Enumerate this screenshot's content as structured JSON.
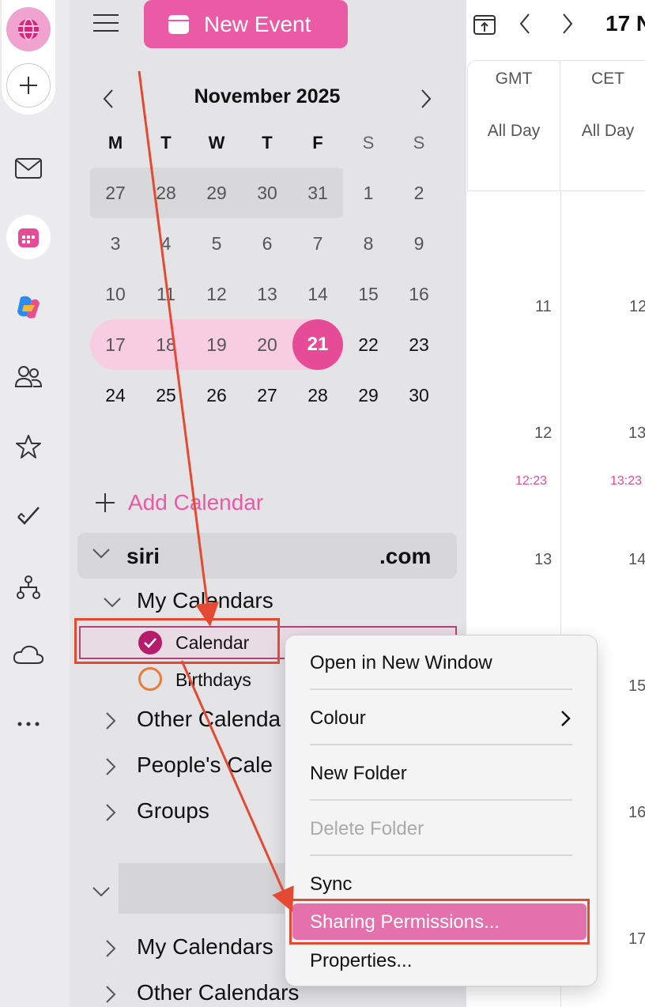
{
  "toolbar": {
    "new_event_label": "New Event",
    "date_label": "17 N"
  },
  "mini_calendar": {
    "month_title": "November 2025",
    "weekdays": [
      "M",
      "T",
      "W",
      "T",
      "F",
      "S",
      "S"
    ],
    "weeks": [
      [
        "27",
        "28",
        "29",
        "30",
        "31",
        "1",
        "2"
      ],
      [
        "3",
        "4",
        "5",
        "6",
        "7",
        "8",
        "9"
      ],
      [
        "10",
        "11",
        "12",
        "13",
        "14",
        "15",
        "16"
      ],
      [
        "17",
        "18",
        "19",
        "20",
        "21",
        "22",
        "23"
      ],
      [
        "24",
        "25",
        "26",
        "27",
        "28",
        "29",
        "30"
      ]
    ],
    "today": "21"
  },
  "sidebar": {
    "add_calendar": "Add Calendar",
    "account1_prefix": "siri",
    "account1_suffix": ".com",
    "my_calendars": "My Calendars",
    "calendar_item": "Calendar",
    "birthdays_item": "Birthdays",
    "other_calendars": "Other Calenda",
    "peoples_calendars": "People's Cale",
    "groups": "Groups",
    "my_calendars_2": "My Calendars",
    "other_calendars_2": "Other Calendars"
  },
  "grid": {
    "tz1": "GMT",
    "tz2": "CET",
    "allday": "All Day",
    "hours_gmt": [
      "11",
      "12",
      "13"
    ],
    "hours_cet": [
      "12",
      "13",
      "14",
      "15",
      "16",
      "17"
    ],
    "now_gmt": "12:23",
    "now_cet": "13:23"
  },
  "context_menu": {
    "open_new_window": "Open in New Window",
    "colour": "Colour",
    "new_folder": "New Folder",
    "delete_folder": "Delete Folder",
    "sync": "Sync",
    "sharing_permissions": "Sharing Permissions...",
    "properties": "Properties..."
  },
  "colors": {
    "accent": "#ea5aa5",
    "annotation": "#e44a32"
  }
}
